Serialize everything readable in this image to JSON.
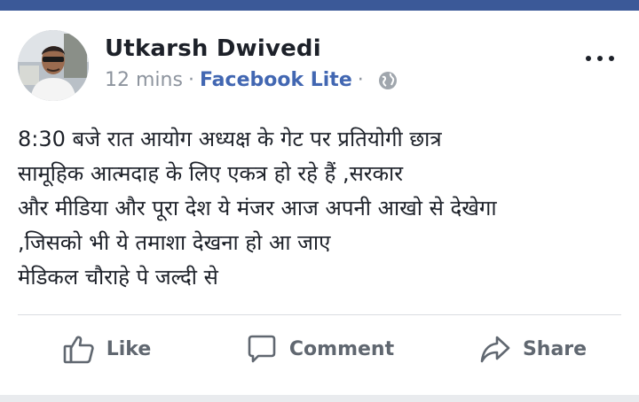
{
  "post": {
    "author": "Utkarsh Dwivedi",
    "time": "12 mins",
    "separator": "·",
    "via": "Facebook Lite",
    "privacy_icon": "globe-icon",
    "more_icon": "more-options-icon",
    "body_lines": [
      "8:30 बजे रात आयोग अध्यक्ष के गेट पर प्रतियोगी छात्र",
      "सामूहिक आत्मदाह के लिए एकत्र हो रहे हैं ,सरकार",
      "और मीडिया और पूरा देश ये मंजर आज अपनी आखो से देखेगा",
      ",जिसको भी ये तमाशा देखना हो आ जाए",
      "मेडिकल चौराहे पे जल्दी से"
    ]
  },
  "actions": {
    "like_label": "Like",
    "comment_label": "Comment",
    "share_label": "Share"
  },
  "colors": {
    "brand": "#3b5998",
    "link": "#4267b2",
    "muted": "#8d949e"
  }
}
